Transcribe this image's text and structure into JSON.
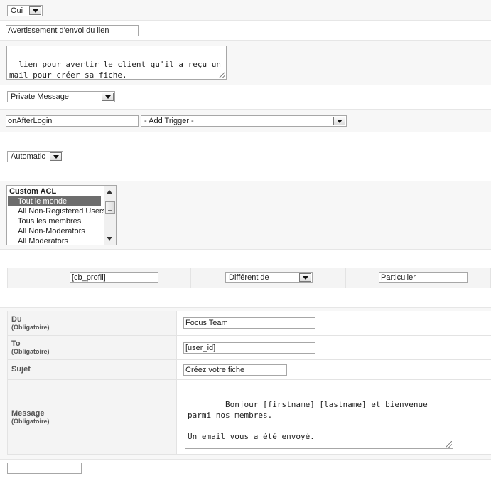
{
  "enabled_select": "Oui",
  "link_title_input": "Avertissement d'envoi du lien",
  "description_text": "lien pour avertir le client qu'il a reçu un mail pour créer sa fiche.",
  "message_type_select": "Private Message",
  "trigger_input": "onAfterLogin",
  "add_trigger_select": "- Add Trigger -",
  "mode_select": "Automatic",
  "acl_list": {
    "group": "Custom ACL",
    "options": [
      "Tout le monde",
      "All Non-Registered Users",
      "Tous les membres",
      "All Non-Moderators",
      "All Moderators"
    ],
    "selected": "Tout le monde"
  },
  "condition": {
    "field": "[cb_profil]",
    "operator": "Différent de",
    "value": "Particulier"
  },
  "message_form": {
    "from_label": "Du",
    "from_required": "(Obligatoire)",
    "from_value": "Focus Team",
    "to_label": "To",
    "to_required": "(Obligatoire)",
    "to_value": "[user_id]",
    "subject_label": "Sujet",
    "subject_value": "Créez votre fiche",
    "message_label": "Message",
    "message_required": "(Obligatoire)",
    "message_value": "Bonjour [firstname] [lastname] et bienvenue parmi nos membres.\n\nUn email vous a été envoyé.\n\nLa Focus Team"
  },
  "bottom_input": ""
}
